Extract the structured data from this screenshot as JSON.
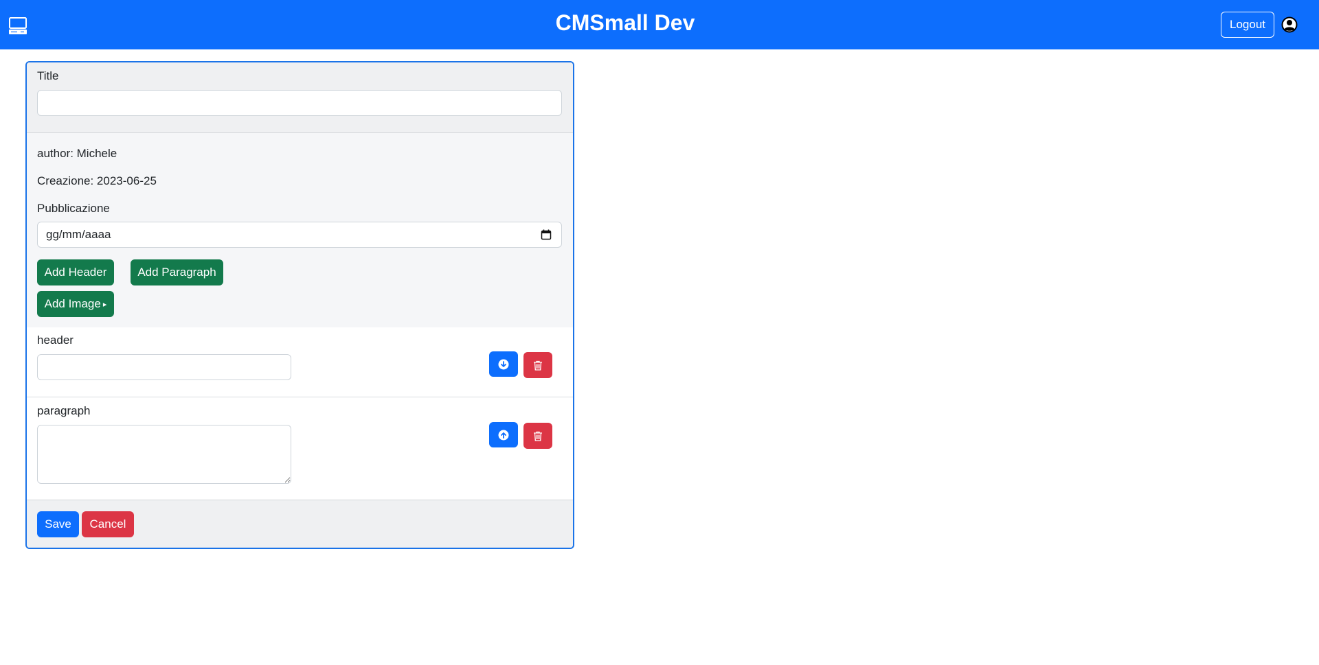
{
  "navbar": {
    "title": "CMSmall Dev",
    "logout_label": "Logout",
    "brand_icon": "laptop-icon",
    "user_icon": "person-circle-icon",
    "color": "#0d6efd"
  },
  "form": {
    "title_label": "Title",
    "title_value": "",
    "author_text": "author: Michele",
    "creation_text": "Creazione: 2023-06-25",
    "publication_label": "Pubblicazione",
    "publication_placeholder": "gg/mm/aaaa",
    "add_header_label": "Add Header",
    "add_paragraph_label": "Add Paragraph",
    "add_image_label": "Add Image",
    "blocks": [
      {
        "type": "header",
        "label": "header",
        "value": "",
        "move_icon": "arrow-down-circle-icon",
        "delete_icon": "trash-icon"
      },
      {
        "type": "paragraph",
        "label": "paragraph",
        "value": "",
        "move_icon": "arrow-up-circle-icon",
        "delete_icon": "trash-icon"
      }
    ],
    "save_label": "Save",
    "cancel_label": "Cancel"
  },
  "colors": {
    "primary": "#0d6efd",
    "success": "#137a4c",
    "danger": "#dc3545"
  }
}
